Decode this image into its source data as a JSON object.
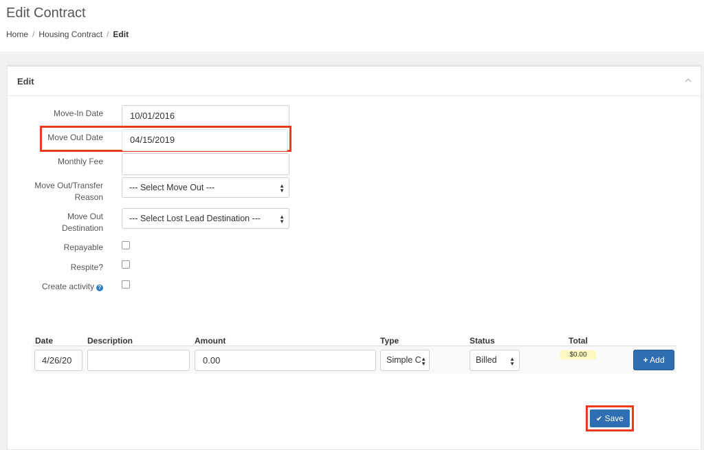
{
  "header": {
    "title": "Edit Contract",
    "breadcrumb": [
      {
        "label": "Home"
      },
      {
        "label": "Housing Contract"
      },
      {
        "label": "Edit"
      }
    ],
    "separator": "/"
  },
  "panel": {
    "title": "Edit",
    "collapse_icon": "chevron-up-icon"
  },
  "form": {
    "move_in_date": {
      "label": "Move-In Date",
      "value": "10/01/2016"
    },
    "move_out_date": {
      "label": "Move Out Date",
      "value": "04/15/2019"
    },
    "monthly_fee": {
      "label": "Monthly Fee",
      "value": ""
    },
    "move_out_reason": {
      "label_line1": "Move Out/Transfer",
      "label_line2": "Reason",
      "selected": "--- Select Move Out ---"
    },
    "move_out_destination": {
      "label_line1": "Move Out",
      "label_line2": "Destination",
      "selected": "--- Select Lost Lead Destination ---"
    },
    "repayable": {
      "label": "Repayable",
      "checked": false
    },
    "respite": {
      "label": "Respite?",
      "checked": false
    },
    "create_activity": {
      "label": "Create activity",
      "checked": false,
      "help_icon": "question-circle-icon",
      "help_glyph": "?"
    }
  },
  "charges_table": {
    "columns": [
      "Date",
      "Description",
      "Amount",
      "Type",
      "Status",
      "Total"
    ],
    "row": {
      "date": "4/26/20",
      "description": "",
      "amount": "0.00",
      "type": "Simple C",
      "status": "Billed",
      "total": "$0.00"
    },
    "add_button": {
      "label": "Add",
      "icon": "plus-icon",
      "glyph": "+"
    }
  },
  "save_button": {
    "label": "Save",
    "icon": "check-icon",
    "glyph": "✔"
  },
  "colors": {
    "primary": "#2f6eb0",
    "highlight": "#ea3a1c",
    "total_badge": "#fcf8bf"
  }
}
